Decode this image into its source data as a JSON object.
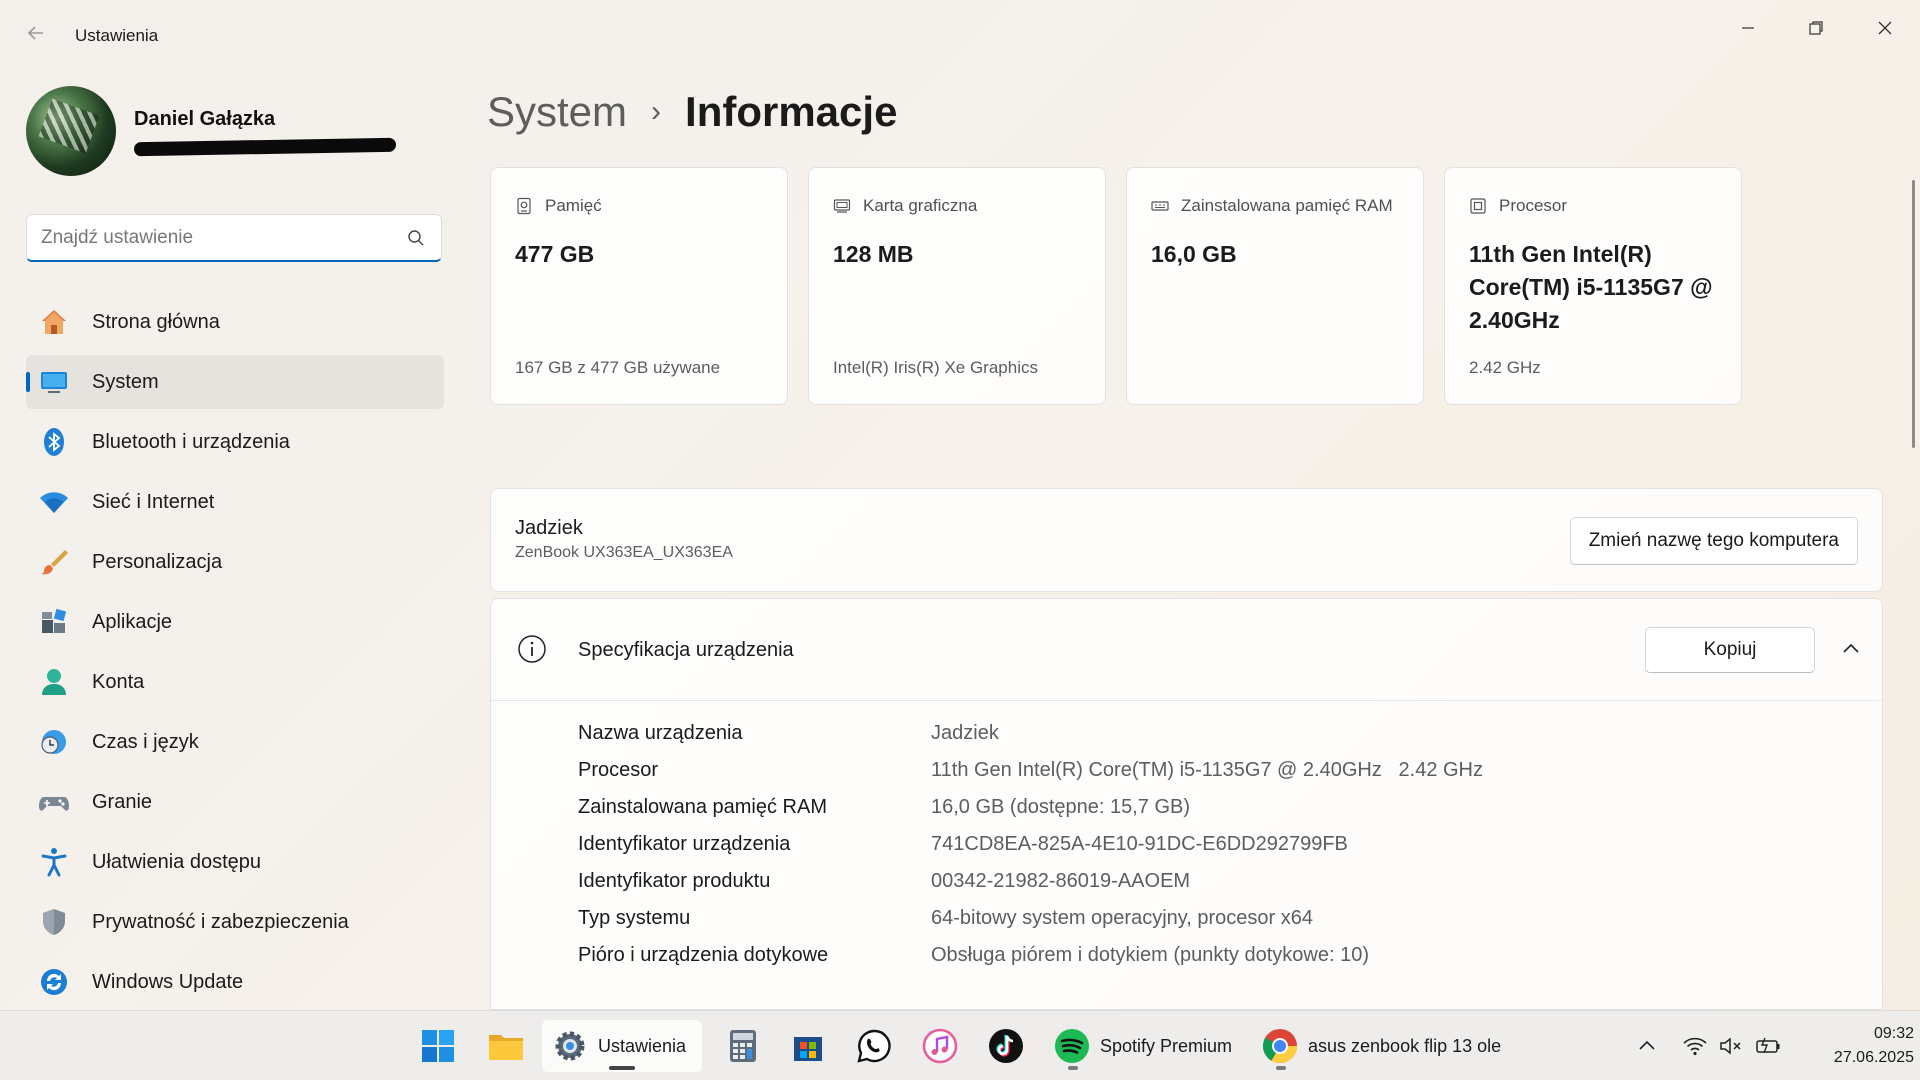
{
  "window": {
    "title": "Ustawienia",
    "back_icon": "back-arrow-icon",
    "controls": [
      "minimize-icon",
      "maximize-icon",
      "close-icon"
    ]
  },
  "profile": {
    "name": "Daniel Gałązka",
    "email_obscured": true
  },
  "search": {
    "placeholder": "Znajdź ustawienie",
    "value": ""
  },
  "sidebar": {
    "items": [
      {
        "label": "Strona główna",
        "icon": "home-icon",
        "active": false
      },
      {
        "label": "System",
        "icon": "monitor-icon",
        "active": true
      },
      {
        "label": "Bluetooth i urządzenia",
        "icon": "bluetooth-icon",
        "active": false
      },
      {
        "label": "Sieć i Internet",
        "icon": "wifi-icon",
        "active": false
      },
      {
        "label": "Personalizacja",
        "icon": "brush-icon",
        "active": false
      },
      {
        "label": "Aplikacje",
        "icon": "apps-icon",
        "active": false
      },
      {
        "label": "Konta",
        "icon": "person-icon",
        "active": false
      },
      {
        "label": "Czas i język",
        "icon": "clock-globe-icon",
        "active": false
      },
      {
        "label": "Granie",
        "icon": "gamepad-icon",
        "active": false
      },
      {
        "label": "Ułatwienia dostępu",
        "icon": "accessibility-icon",
        "active": false
      },
      {
        "label": "Prywatność i zabezpieczenia",
        "icon": "shield-icon",
        "active": false
      },
      {
        "label": "Windows Update",
        "icon": "update-icon",
        "active": false
      }
    ]
  },
  "breadcrumb": {
    "parent": "System",
    "separator": "›",
    "current": "Informacje"
  },
  "cards": [
    {
      "title": "Pamięć",
      "icon": "storage-icon",
      "value": "477 GB",
      "sub": "167 GB z 477 GB używane"
    },
    {
      "title": "Karta graficzna",
      "icon": "gpu-icon",
      "value": "128 MB",
      "sub": "Intel(R) Iris(R) Xe Graphics"
    },
    {
      "title": "Zainstalowana pamięć RAM",
      "icon": "ram-icon",
      "value": "16,0 GB",
      "sub": ""
    },
    {
      "title": "Procesor",
      "icon": "cpu-icon",
      "value": "11th Gen Intel(R) Core(TM) i5-1135G7 @ 2.40GHz",
      "sub": "2.42 GHz"
    }
  ],
  "computer": {
    "name": "Jadziek",
    "model": "ZenBook UX363EA_UX363EA",
    "rename_label": "Zmień nazwę tego komputera"
  },
  "specs": {
    "title": "Specyfikacja urządzenia",
    "copy_label": "Kopiuj",
    "expanded": true,
    "rows": [
      {
        "key": "Nazwa urządzenia",
        "value": "Jadziek"
      },
      {
        "key": "Procesor",
        "value": "11th Gen Intel(R) Core(TM) i5-1135G7 @ 2.40GHz   2.42 GHz"
      },
      {
        "key": "Zainstalowana pamięć RAM",
        "value": "16,0 GB (dostępne: 15,7 GB)"
      },
      {
        "key": "Identyfikator urządzenia",
        "value": "741CD8EA-825A-4E10-91DC-E6DD292799FB"
      },
      {
        "key": "Identyfikator produktu",
        "value": "00342-21982-86019-AAOEM"
      },
      {
        "key": "Typ systemu",
        "value": "64-bitowy system operacyjny, procesor x64"
      },
      {
        "key": "Pióro i urządzenia dotykowe",
        "value": "Obsługa piórem i dotykiem (punkty dotykowe: 10)"
      }
    ]
  },
  "taskbar": {
    "items": [
      {
        "name": "start",
        "icon": "windows-start-icon",
        "label": ""
      },
      {
        "name": "file-explorer",
        "icon": "folder-icon",
        "label": ""
      },
      {
        "name": "settings",
        "icon": "gear-icon",
        "label": "Ustawienia",
        "active": true
      },
      {
        "name": "calculator",
        "icon": "calculator-icon",
        "label": ""
      },
      {
        "name": "store",
        "icon": "store-icon",
        "label": ""
      },
      {
        "name": "whatsapp",
        "icon": "whatsapp-icon",
        "label": ""
      },
      {
        "name": "itunes",
        "icon": "music-icon",
        "label": ""
      },
      {
        "name": "tiktok",
        "icon": "tiktok-icon",
        "label": ""
      },
      {
        "name": "spotify",
        "icon": "spotify-icon",
        "label": "Spotify Premium"
      },
      {
        "name": "chrome",
        "icon": "chrome-icon",
        "label": "asus zenbook flip 13 ole"
      }
    ],
    "tray": [
      "chevron-up-icon",
      "wifi-icon",
      "volume-muted-icon",
      "battery-charging-icon"
    ],
    "time": "09:32",
    "date": "27.06.2025"
  },
  "colors": {
    "accent": "#0067c0",
    "spotify": "#1db954",
    "whatsapp": "#25d366"
  }
}
